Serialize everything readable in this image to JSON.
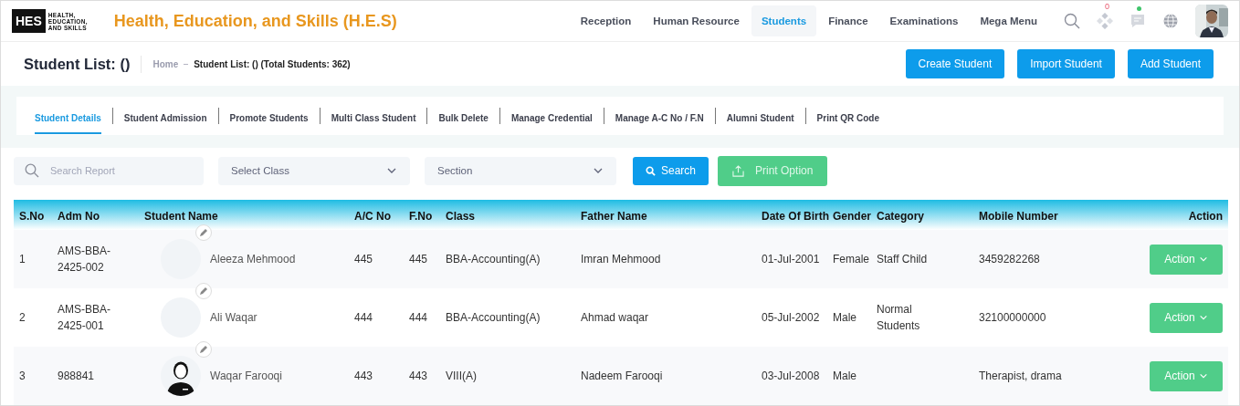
{
  "header": {
    "logo": {
      "mark": "HES",
      "lines": [
        "HEALTH,",
        "EDUCATION,",
        "AND SKILLS"
      ]
    },
    "title": "Health, Education, and Skills (H.E.S)",
    "nav": [
      {
        "label": "Reception",
        "selected": false
      },
      {
        "label": "Human Resource",
        "selected": false
      },
      {
        "label": "Students",
        "selected": true
      },
      {
        "label": "Finance",
        "selected": false
      },
      {
        "label": "Examinations",
        "selected": false
      },
      {
        "label": "Mega Menu",
        "selected": false
      }
    ],
    "apps_badge": "0"
  },
  "page_header": {
    "title": "Student List: ()",
    "breadcrumb": [
      "Home",
      "Student List: () (Total Students: 362)"
    ],
    "buttons": [
      "Create Student",
      "Import Student",
      "Add Student"
    ]
  },
  "tabs": [
    {
      "label": "Student Details",
      "selected": true
    },
    {
      "label": "Student Admission",
      "selected": false
    },
    {
      "label": "Promote Students",
      "selected": false
    },
    {
      "label": "Multi Class Student",
      "selected": false
    },
    {
      "label": "Bulk Delete",
      "selected": false
    },
    {
      "label": "Manage Credential",
      "selected": false
    },
    {
      "label": "Manage A-C No / F.N",
      "selected": false
    },
    {
      "label": "Alumni Student",
      "selected": false
    },
    {
      "label": "Print QR Code",
      "selected": false
    }
  ],
  "filters": {
    "search": {
      "placeholder": "Search Report"
    },
    "class_select": {
      "placeholder": "Select Class"
    },
    "section_select": {
      "placeholder": "Section"
    },
    "search_button": "Search",
    "print_button": "Print Option"
  },
  "table": {
    "columns": [
      "S.No",
      "Adm No",
      "Student Name",
      "A/C No",
      "F.No",
      "Class",
      "Father Name",
      "Date Of Birth",
      "Gender",
      "Category",
      "Mobile Number",
      "Action"
    ],
    "rows": [
      {
        "sno": "1",
        "adm_no": "AMS-BBA-2425-002",
        "avatar": {
          "kind": "blank"
        },
        "name": "Aleeza Mehmood",
        "ac_no": "445",
        "f_no": "445",
        "class": "BBA-Accounting(A)",
        "father": "Imran Mehmood",
        "dob": "01-Jul-2001",
        "gender": "Female",
        "category": "Staff Child",
        "mobile": "3459282268",
        "action": "Action"
      },
      {
        "sno": "2",
        "adm_no": "AMS-BBA-2425-001",
        "avatar": {
          "kind": "blank"
        },
        "name": "Ali Waqar",
        "ac_no": "444",
        "f_no": "444",
        "class": "BBA-Accounting(A)",
        "father": "Ahmad waqar",
        "dob": "05-Jul-2002",
        "gender": "Male",
        "category": "Normal Students",
        "mobile": "32100000000",
        "action": "Action"
      },
      {
        "sno": "3",
        "adm_no": "988841",
        "avatar": {
          "kind": "silhouette"
        },
        "name": "Waqar Farooqi",
        "ac_no": "443",
        "f_no": "443",
        "class": "VIII(A)",
        "father": "Nadeem Farooqi",
        "dob": "03-Jul-2008",
        "gender": "Male",
        "mobile": "Therapist, drama",
        "action": "Action"
      }
    ]
  }
}
